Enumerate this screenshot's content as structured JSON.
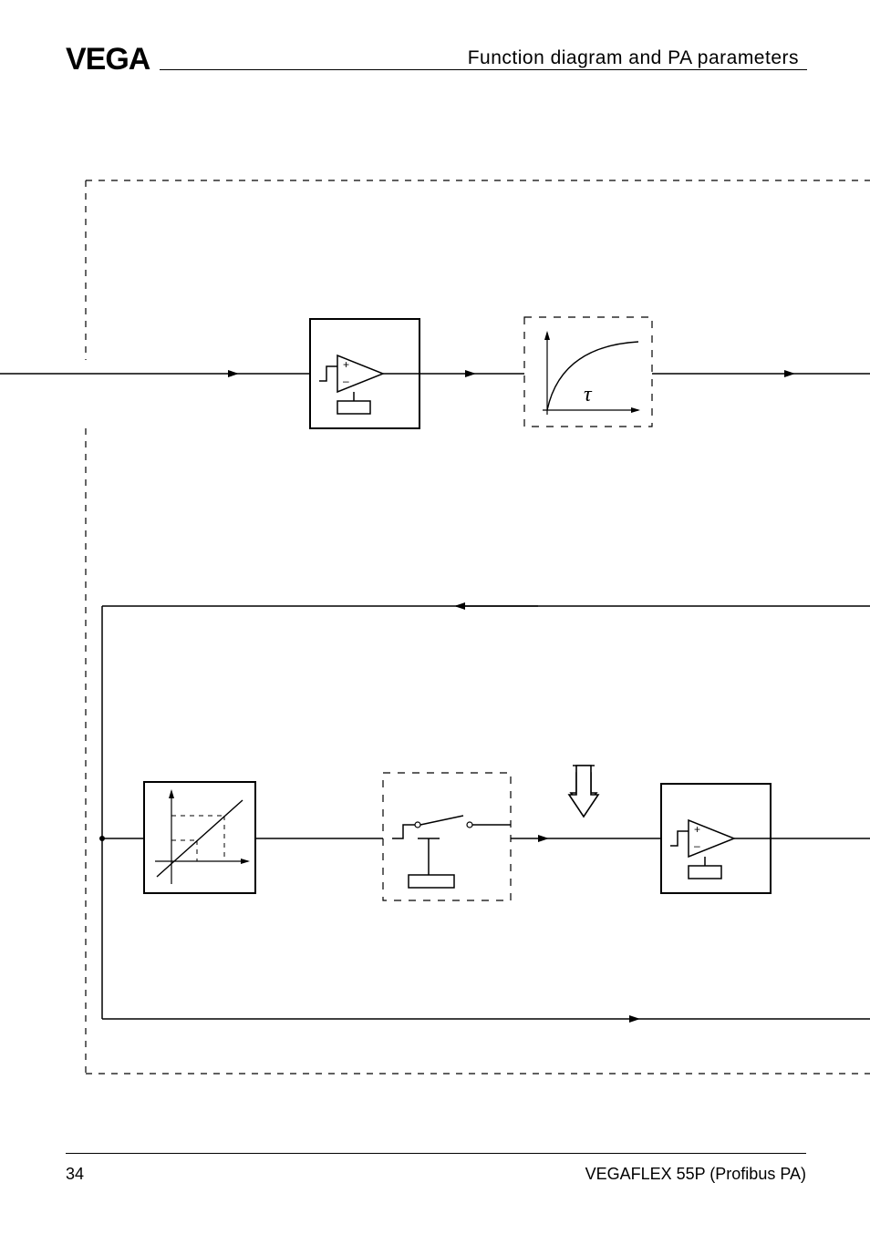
{
  "header": {
    "title": "Function diagram and PA parameters"
  },
  "footer": {
    "page_number": "34",
    "doc_title": "VEGAFLEX 55P (Profibus PA)"
  },
  "logo": {
    "text": "VEGA"
  },
  "diagram": {
    "tau_symbol": "τ",
    "plus": "+",
    "minus": "–"
  }
}
